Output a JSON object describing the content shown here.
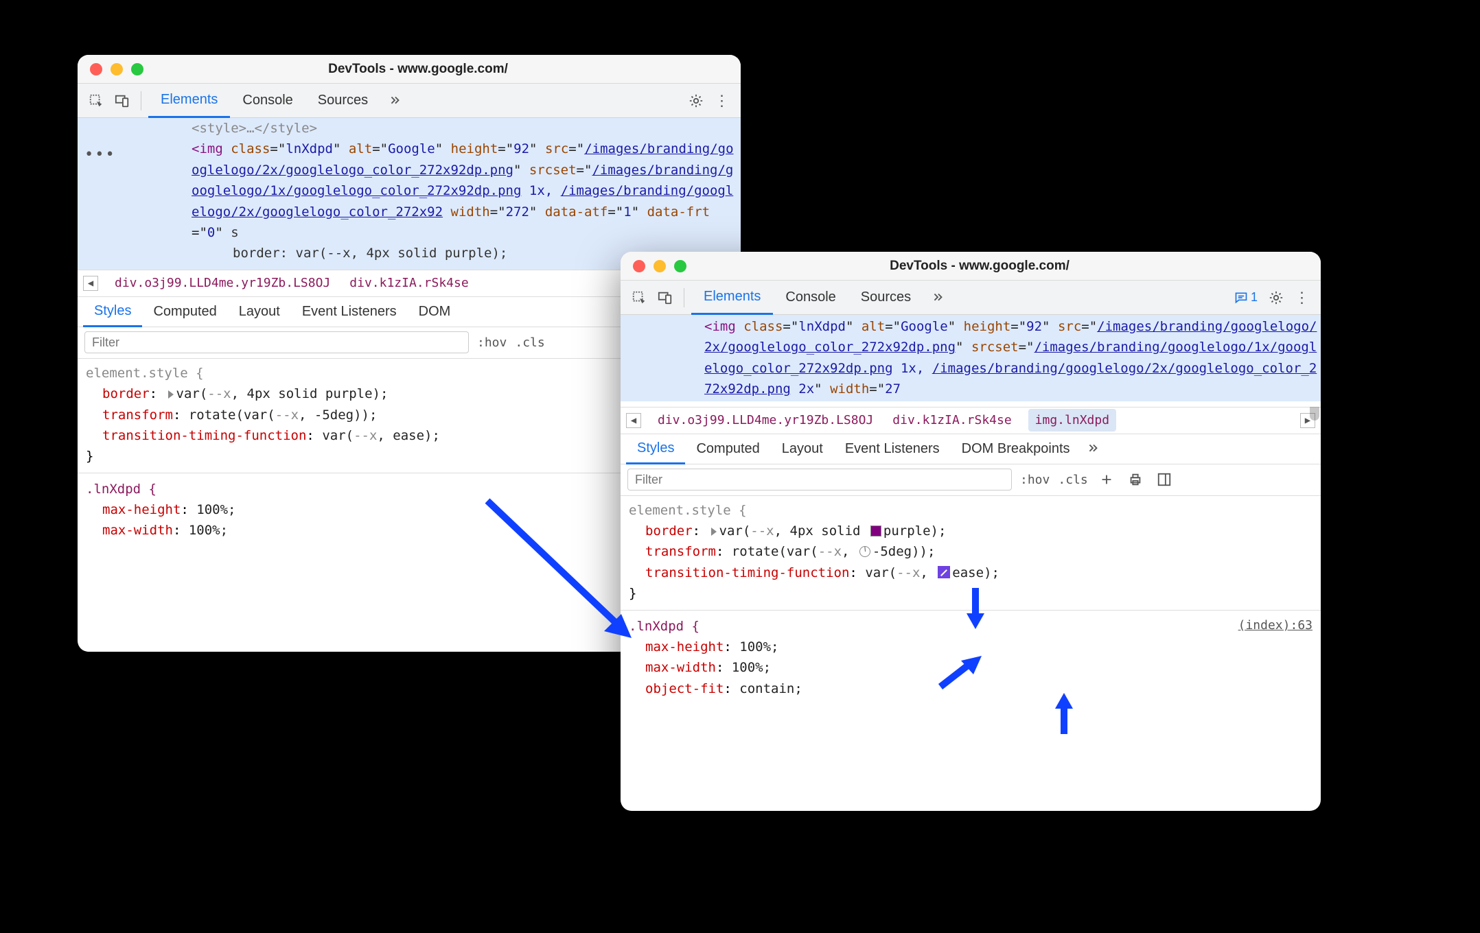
{
  "windowA": {
    "title": "DevTools - www.google.com/",
    "tabs": {
      "elements": "Elements",
      "console": "Console",
      "sources": "Sources"
    },
    "dom": {
      "style_open": "<style>",
      "style_close": "</style>",
      "img_open": "<img",
      "attr_class": "class",
      "val_class": "lnXdpd",
      "attr_alt": "alt",
      "val_alt": "Google",
      "attr_height": "height",
      "val_height": "92",
      "attr_src": "src",
      "val_src": "/images/branding/googlelogo/2x/googlelogo_color_272x92dp.png",
      "attr_srcset": "srcset",
      "val_srcset1": "/images/branding/googlelogo/1x/googlelogo_color_272x92dp.png",
      "val_srcset1x": " 1x, ",
      "val_srcset2": "/images/branding/googlelogo/2x/googlelogo_color_272x92",
      "attr_width": "width",
      "val_width": "272",
      "attr_dataatf": "data-atf",
      "val_dataatf": "1",
      "attr_datafrt": "data-frt",
      "val_datafrt": "0",
      "trailing": " s",
      "border_line": "border: var(--x, 4px solid purple);"
    },
    "breadcrumbs": {
      "b1": "div.o3j99.LLD4me.yr19Zb.LS8OJ",
      "b2": "div.k1zIA.rSk4se"
    },
    "subtabs": {
      "styles": "Styles",
      "computed": "Computed",
      "layout": "Layout",
      "events": "Event Listeners",
      "dom": "DOM "
    },
    "filter": {
      "placeholder": "Filter",
      "hov": ":hov",
      "cls": ".cls"
    },
    "styles": {
      "elementstyle": "element.style {",
      "border_prop": "border",
      "border_val_pre": "var(",
      "border_var": "--x",
      "border_val_post": ", 4px solid purple);",
      "transform_prop": "transform",
      "transform_val_pre": "rotate(var(",
      "transform_var": "--x",
      "transform_val_post": ", -5deg));",
      "ttf_prop": "transition-timing-function",
      "ttf_val_pre": "var(",
      "ttf_var": "--x",
      "ttf_val_post": ", ease);",
      "close": "}",
      "lnxdpd_sel": ".lnXdpd {",
      "maxh_prop": "max-height",
      "maxh_val": "100%;",
      "maxw_prop": "max-width",
      "maxw_val": "100%;"
    }
  },
  "windowB": {
    "title": "DevTools - www.google.com/",
    "chat_count": "1",
    "tabs": {
      "elements": "Elements",
      "console": "Console",
      "sources": "Sources"
    },
    "dom": {
      "img_open": "<img",
      "attr_class": "class",
      "val_class": "lnXdpd",
      "attr_alt": "alt",
      "val_alt": "Google",
      "attr_height": "height",
      "val_height": "92",
      "attr_src": "src",
      "val_src": "/images/branding/googlelogo/2x/googlelogo_color_272x92dp.png",
      "attr_srcset": "srcset",
      "val_srcset1": "/images/branding/googlelogo/1x/googlelogo_color_272x92dp.png",
      "val_srcset1x": " 1x, ",
      "val_srcset2": "/images/branding/googlelogo/2x/googlelogo_color_272x92dp.png",
      "val_srcset2x": " 2x",
      "attr_width": "width",
      "val_width": "27"
    },
    "breadcrumbs": {
      "b1": "div.o3j99.LLD4me.yr19Zb.LS8OJ",
      "b2": "div.k1zIA.rSk4se",
      "b3": "img.lnXdpd"
    },
    "subtabs": {
      "styles": "Styles",
      "computed": "Computed",
      "layout": "Layout",
      "events": "Event Listeners",
      "dom": "DOM Breakpoints"
    },
    "filter": {
      "placeholder": "Filter",
      "hov": ":hov",
      "cls": ".cls"
    },
    "styles": {
      "elementstyle": "element.style {",
      "border_prop": "border",
      "border_val_pre": "var(",
      "border_var": "--x",
      "border_mid": ", 4px solid ",
      "border_color": "purple",
      "border_end": ");",
      "transform_prop": "transform",
      "transform_val_pre": "rotate(var(",
      "transform_var": "--x",
      "transform_mid": ", ",
      "transform_deg": "-5deg",
      "transform_end": "));",
      "ttf_prop": "transition-timing-function",
      "ttf_val_pre": "var(",
      "ttf_var": "--x",
      "ttf_mid": ", ",
      "ttf_ease": "ease",
      "ttf_end": ");",
      "close": "}",
      "lnxdpd_sel": ".lnXdpd {",
      "rule_src": "(index):63",
      "maxh_prop": "max-height",
      "maxh_val": "100%;",
      "maxw_prop": "max-width",
      "maxw_val": "100%;",
      "objfit_prop": "object-fit",
      "objfit_val": "contain;"
    }
  }
}
